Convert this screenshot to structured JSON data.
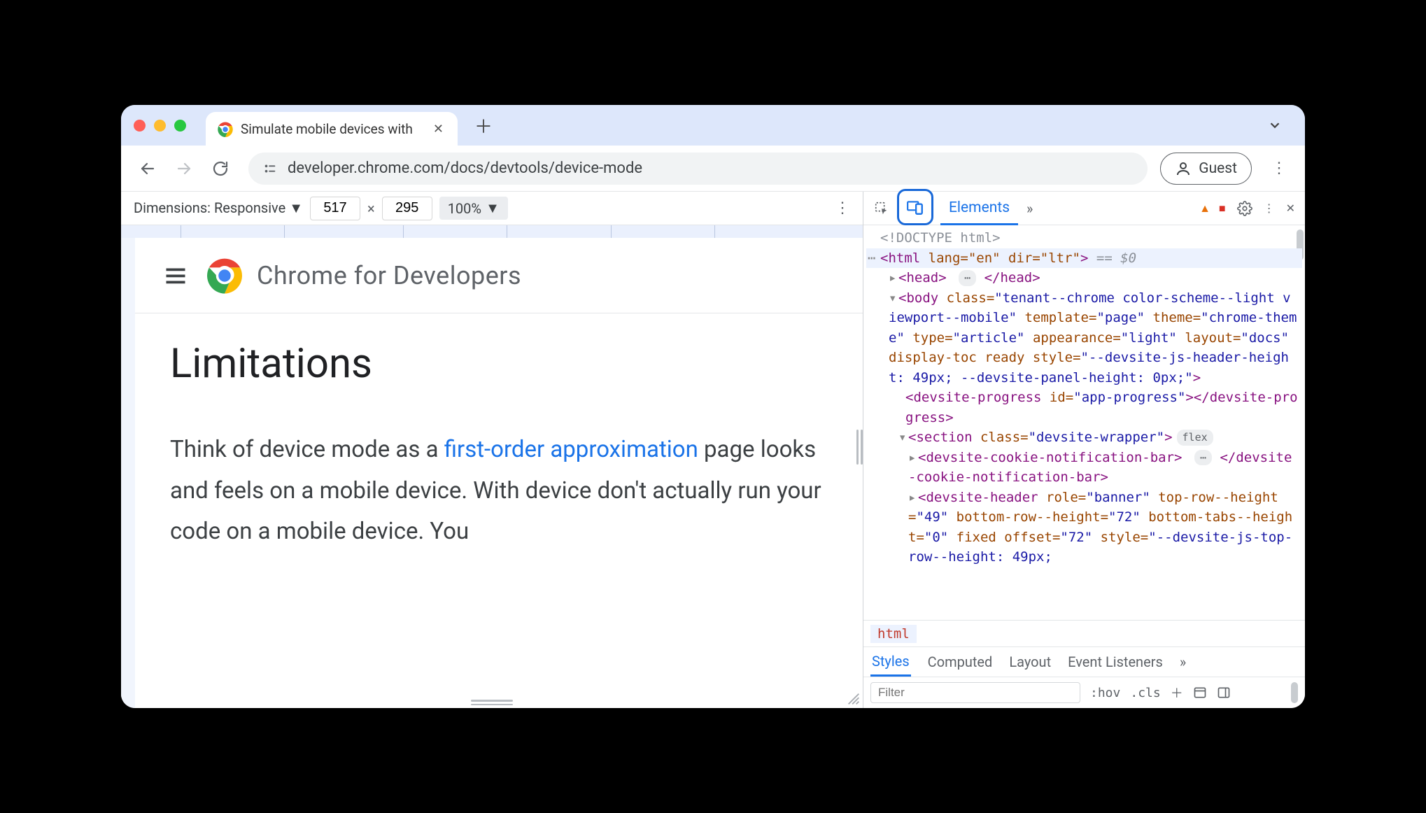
{
  "tab": {
    "title": "Simulate mobile devices with"
  },
  "toolbar": {
    "url": "developer.chrome.com/docs/devtools/device-mode",
    "guest": "Guest"
  },
  "device_toolbar": {
    "label": "Dimensions: Responsive",
    "width": "517",
    "height": "295",
    "cross": "×",
    "zoom": "100%"
  },
  "page": {
    "site_title": "Chrome for Developers",
    "h1": "Limitations",
    "p_before": "Think of device mode as a ",
    "p_link": "first-order approximation",
    "p_after": " page looks and feels on a mobile device. With device don't actually run your code on a mobile device. You"
  },
  "devtools": {
    "tab_elements": "Elements",
    "breadcrumb": "html",
    "styles_tabs": {
      "styles": "Styles",
      "computed": "Computed",
      "layout": "Layout",
      "listeners": "Event Listeners"
    },
    "filter_placeholder": "Filter",
    "hov": ":hov",
    "cls": ".cls"
  },
  "dom": {
    "l1": "<!DOCTYPE html>",
    "l2_open": "<",
    "l2_tag": "html",
    "l2_attrs": " lang=\"en\" dir=\"ltr\"",
    "l2_close": ">",
    "l2_suffix": " == $0",
    "l3": "<head> ⋯ </head>",
    "l4a": "<body class=\"tenant--chrome color-scheme--light viewport--mobile\" template=\"page\" theme=\"chrome-theme\" type=\"article\" appearance=\"light\" layout=\"docs\" display-toc ready style=\"--devsite-js-header-height: 49px; --devsite-panel-height: 0px;\">",
    "l5": "<devsite-progress id=\"app-progress\"></devsite-progress>",
    "l6": "<section class=\"devsite-wrapper\">",
    "l6_badge": "flex",
    "l7": "<devsite-cookie-notification-bar> ⋯ </devsite-cookie-notification-bar>",
    "l8": "<devsite-header role=\"banner\" top-row--height=\"49\" bottom-row--height=\"72\" bottom-tabs--height=\"0\" fixed offset=\"72\" style=\"--devsite-js-top-row--height: 49px;"
  }
}
